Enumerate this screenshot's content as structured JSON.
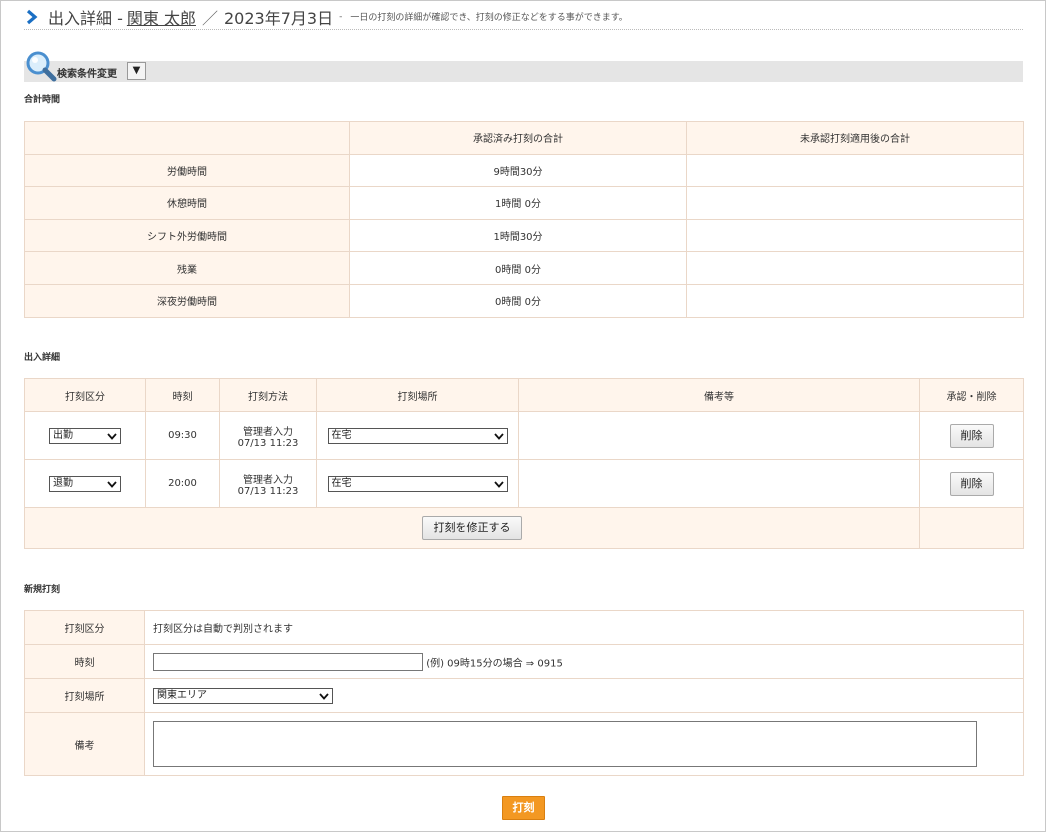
{
  "header": {
    "title": "出入詳細 - ",
    "employee_name": "関東 太郎",
    "separator": "／",
    "date": "2023年7月3日",
    "dash": "-",
    "description": "一日の打刻の詳細が確認でき、打刻の修正などをする事ができます。"
  },
  "search": {
    "label": "検索条件変更",
    "toggle": "▼"
  },
  "totals": {
    "section_label": "合計時間",
    "columns": [
      "",
      "承認済み打刻の合計",
      "未承認打刻適用後の合計"
    ],
    "rows": [
      {
        "label": "労働時間",
        "approved": "9時間30分",
        "unapproved": ""
      },
      {
        "label": "休憩時間",
        "approved": "1時間 0分",
        "unapproved": ""
      },
      {
        "label": "シフト外労働時間",
        "approved": "1時間30分",
        "unapproved": ""
      },
      {
        "label": "残業",
        "approved": "0時間 0分",
        "unapproved": ""
      },
      {
        "label": "深夜労働時間",
        "approved": "0時間 0分",
        "unapproved": ""
      }
    ]
  },
  "detail": {
    "section_label": "出入詳細",
    "columns": [
      "打刻区分",
      "時刻",
      "打刻方法",
      "打刻場所",
      "備考等",
      "承認・削除"
    ],
    "rows": [
      {
        "type": "出勤",
        "time": "09:30",
        "method_line1": "管理者入力",
        "method_line2": "07/13 11:23",
        "place": "在宅",
        "note": "",
        "action": "削除"
      },
      {
        "type": "退勤",
        "time": "20:00",
        "method_line1": "管理者入力",
        "method_line2": "07/13 11:23",
        "place": "在宅",
        "note": "",
        "action": "削除"
      }
    ],
    "modify_button": "打刻を修正する"
  },
  "new_entry": {
    "section_label": "新規打刻",
    "type_label": "打刻区分",
    "type_value": "打刻区分は自動で判別されます",
    "time_label": "時刻",
    "time_value": "",
    "time_hint": "(例) 09時15分の場合 ⇒ 0915",
    "place_label": "打刻場所",
    "place_value": "関東エリア",
    "note_label": "備考",
    "note_value": ""
  },
  "submit_label": "打刻"
}
